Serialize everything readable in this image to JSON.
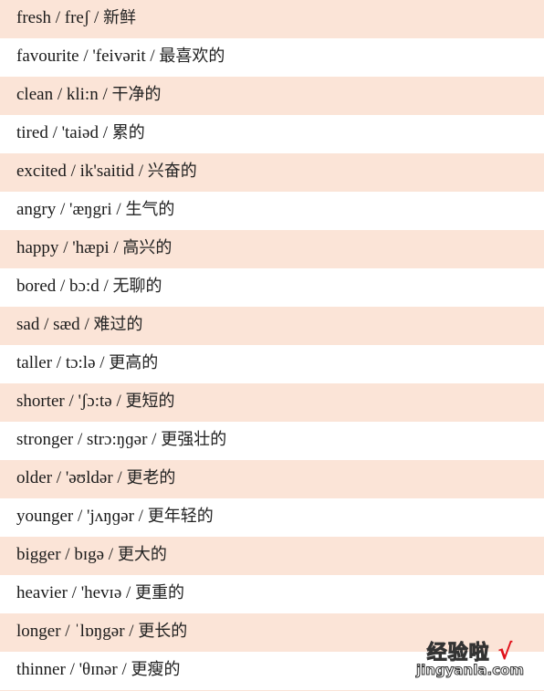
{
  "vocabulary": [
    {
      "word": "fresh",
      "phonetic": "freʃ",
      "meaning": "新鲜"
    },
    {
      "word": "favourite",
      "phonetic": "'feivərit",
      "meaning": "最喜欢的"
    },
    {
      "word": "clean",
      "phonetic": "kli:n",
      "meaning": "干净的"
    },
    {
      "word": "tired",
      "phonetic": "'taiəd",
      "meaning": "累的"
    },
    {
      "word": "excited",
      "phonetic": "ik'saitid",
      "meaning": "兴奋的"
    },
    {
      "word": "angry",
      "phonetic": "'æŋgri",
      "meaning": "生气的"
    },
    {
      "word": "happy",
      "phonetic": "'hæpi",
      "meaning": "高兴的"
    },
    {
      "word": "bored",
      "phonetic": "bɔ:d",
      "meaning": "无聊的"
    },
    {
      "word": "sad",
      "phonetic": "sæd",
      "meaning": "难过的"
    },
    {
      "word": "taller",
      "phonetic": "tɔ:lə",
      "meaning": "更高的"
    },
    {
      "word": "shorter",
      "phonetic": "'ʃɔ:tə",
      "meaning": "更短的"
    },
    {
      "word": "stronger",
      "phonetic": "strɔ:ŋɡər",
      "meaning": "更强壮的"
    },
    {
      "word": "older",
      "phonetic": "'əʊldər",
      "meaning": "更老的"
    },
    {
      "word": "younger",
      "phonetic": "'jʌŋɡər",
      "meaning": "更年轻的"
    },
    {
      "word": "bigger",
      "phonetic": "bɪgə",
      "meaning": "更大的"
    },
    {
      "word": "heavier",
      "phonetic": "'hevɪə",
      "meaning": "更重的"
    },
    {
      "word": "longer",
      "phonetic": "ˈlɒŋgər",
      "meaning": "更长的"
    },
    {
      "word": "thinner",
      "phonetic": "'θɪnər",
      "meaning": "更瘦的"
    }
  ],
  "separator": "/",
  "colors": {
    "row_alt": "#fbe4d7",
    "row_plain": "#ffffff",
    "check": "#e0121b"
  },
  "watermark": {
    "top": "经验啦",
    "check": "√",
    "bottom": "jingyanla.com"
  }
}
